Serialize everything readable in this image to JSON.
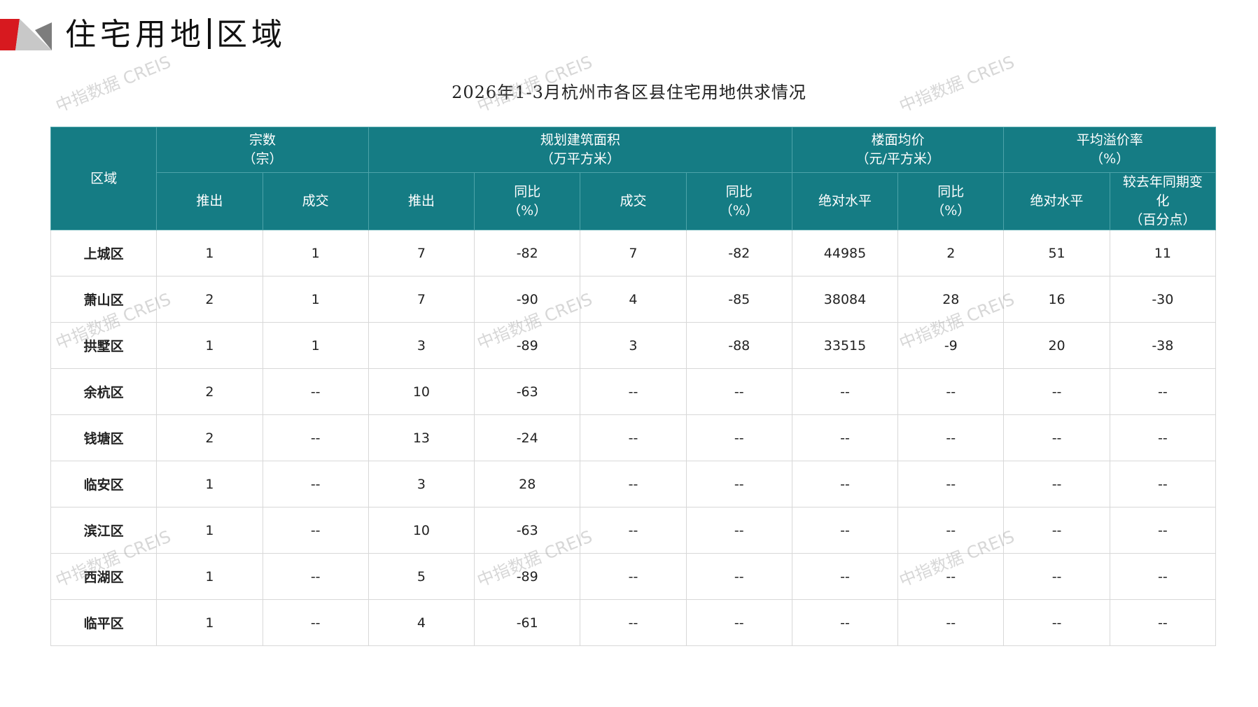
{
  "page": {
    "title_main": "住宅用地",
    "title_sub": "区域"
  },
  "table_title": "2026年1-3月杭州市各区县住宅用地供求情况",
  "watermark": "中指数据 CREIS",
  "colors": {
    "header_bg": "#157c84",
    "logo_red": "#d7191f",
    "logo_gray": "#9a9a9a"
  },
  "header": {
    "region": "区域",
    "groups": [
      {
        "line1": "宗数",
        "line2": "（宗）"
      },
      {
        "line1": "规划建筑面积",
        "line2": "（万平方米）"
      },
      {
        "line1": "楼面均价",
        "line2": "（元/平方米）"
      },
      {
        "line1": "平均溢价率",
        "line2": "（%）"
      }
    ],
    "sub": [
      {
        "line1": "推出",
        "line2": "",
        "line3": ""
      },
      {
        "line1": "成交",
        "line2": "",
        "line3": ""
      },
      {
        "line1": "推出",
        "line2": "",
        "line3": ""
      },
      {
        "line1": "同比",
        "line2": "（%）",
        "line3": ""
      },
      {
        "line1": "成交",
        "line2": "",
        "line3": ""
      },
      {
        "line1": "同比",
        "line2": "（%）",
        "line3": ""
      },
      {
        "line1": "绝对水平",
        "line2": "",
        "line3": ""
      },
      {
        "line1": "同比",
        "line2": "（%）",
        "line3": ""
      },
      {
        "line1": "绝对水平",
        "line2": "",
        "line3": ""
      },
      {
        "line1": "较去年同期变",
        "line2": "化",
        "line3": "（百分点）"
      }
    ]
  },
  "rows": [
    [
      "上城区",
      "1",
      "1",
      "7",
      "-82",
      "7",
      "-82",
      "44985",
      "2",
      "51",
      "11"
    ],
    [
      "萧山区",
      "2",
      "1",
      "7",
      "-90",
      "4",
      "-85",
      "38084",
      "28",
      "16",
      "-30"
    ],
    [
      "拱墅区",
      "1",
      "1",
      "3",
      "-89",
      "3",
      "-88",
      "33515",
      "-9",
      "20",
      "-38"
    ],
    [
      "余杭区",
      "2",
      "--",
      "10",
      "-63",
      "--",
      "--",
      "--",
      "--",
      "--",
      "--"
    ],
    [
      "钱塘区",
      "2",
      "--",
      "13",
      "-24",
      "--",
      "--",
      "--",
      "--",
      "--",
      "--"
    ],
    [
      "临安区",
      "1",
      "--",
      "3",
      "28",
      "--",
      "--",
      "--",
      "--",
      "--",
      "--"
    ],
    [
      "滨江区",
      "1",
      "--",
      "10",
      "-63",
      "--",
      "--",
      "--",
      "--",
      "--",
      "--"
    ],
    [
      "西湖区",
      "1",
      "--",
      "5",
      "-89",
      "--",
      "--",
      "--",
      "--",
      "--",
      "--"
    ],
    [
      "临平区",
      "1",
      "--",
      "4",
      "-61",
      "--",
      "--",
      "--",
      "--",
      "--",
      "--"
    ]
  ]
}
